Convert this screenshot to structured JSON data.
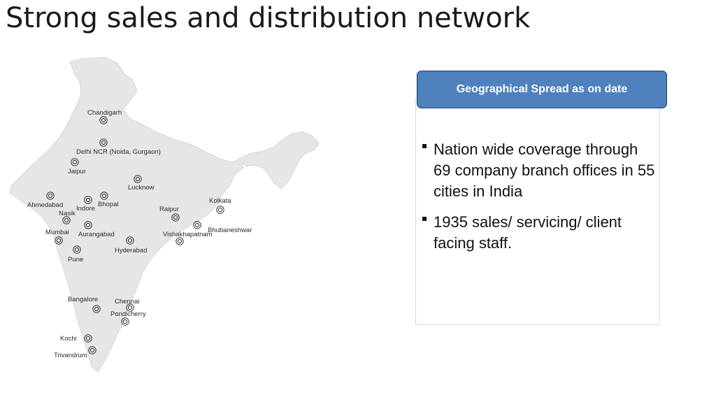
{
  "title": "Strong sales and distribution network",
  "map": {
    "fill_color": "#e6e6e6",
    "marker_icon": "location-target-icon",
    "cities": [
      {
        "id": "chandigarh",
        "name": "Chandigarh"
      },
      {
        "id": "delhi",
        "name": "Delhi NCR (Noida, Gurgaon)"
      },
      {
        "id": "jaipur",
        "name": "Jaipur"
      },
      {
        "id": "lucknow",
        "name": "Lucknow"
      },
      {
        "id": "ahmedabad",
        "name": "Ahmedabad"
      },
      {
        "id": "indore",
        "name": "Indore"
      },
      {
        "id": "bhopal",
        "name": "Bhopal"
      },
      {
        "id": "nasik",
        "name": "Nasik"
      },
      {
        "id": "raipur",
        "name": "Raipur"
      },
      {
        "id": "kolkata",
        "name": "Kolkata"
      },
      {
        "id": "mumbai",
        "name": "Mumbai"
      },
      {
        "id": "aurangabad",
        "name": "Aurangabad"
      },
      {
        "id": "bhubaneshwar",
        "name": "Bhubaneshwar"
      },
      {
        "id": "vishakhapatnam",
        "name": "Vishakhapatnam"
      },
      {
        "id": "hyderabad",
        "name": "Hyderabad"
      },
      {
        "id": "pune",
        "name": "Pune"
      },
      {
        "id": "bangalore",
        "name": "Bangalore"
      },
      {
        "id": "chennai",
        "name": "Chennai"
      },
      {
        "id": "pondicherry",
        "name": "Pondicherry"
      },
      {
        "id": "kochi",
        "name": "Kochi"
      },
      {
        "id": "trivandrum",
        "name": "Trivandrum"
      }
    ]
  },
  "panel": {
    "header": "Geographical Spread as on date",
    "header_color": "#4f81bd",
    "bullets": [
      "Nation wide coverage through 69 company branch offices in 55 cities in India",
      "1935 sales/ servicing/ client facing staff."
    ]
  }
}
